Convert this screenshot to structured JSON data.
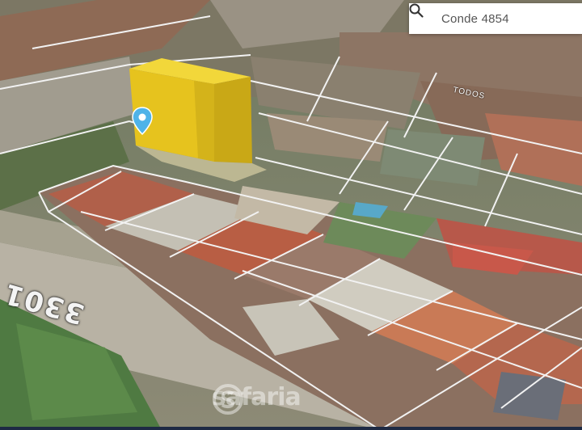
{
  "search": {
    "value": "Conde 4854",
    "icon": "search-icon"
  },
  "map": {
    "road_number": "3301",
    "street_label": "TODOS",
    "watermark": "safaria",
    "pin_icon": "map-pin-icon",
    "colors": {
      "building": "#e6c31e",
      "pin": "#4fb3e8",
      "lot_lines": "#f2f2f2",
      "bottom_bar": "#1e2a44"
    }
  }
}
